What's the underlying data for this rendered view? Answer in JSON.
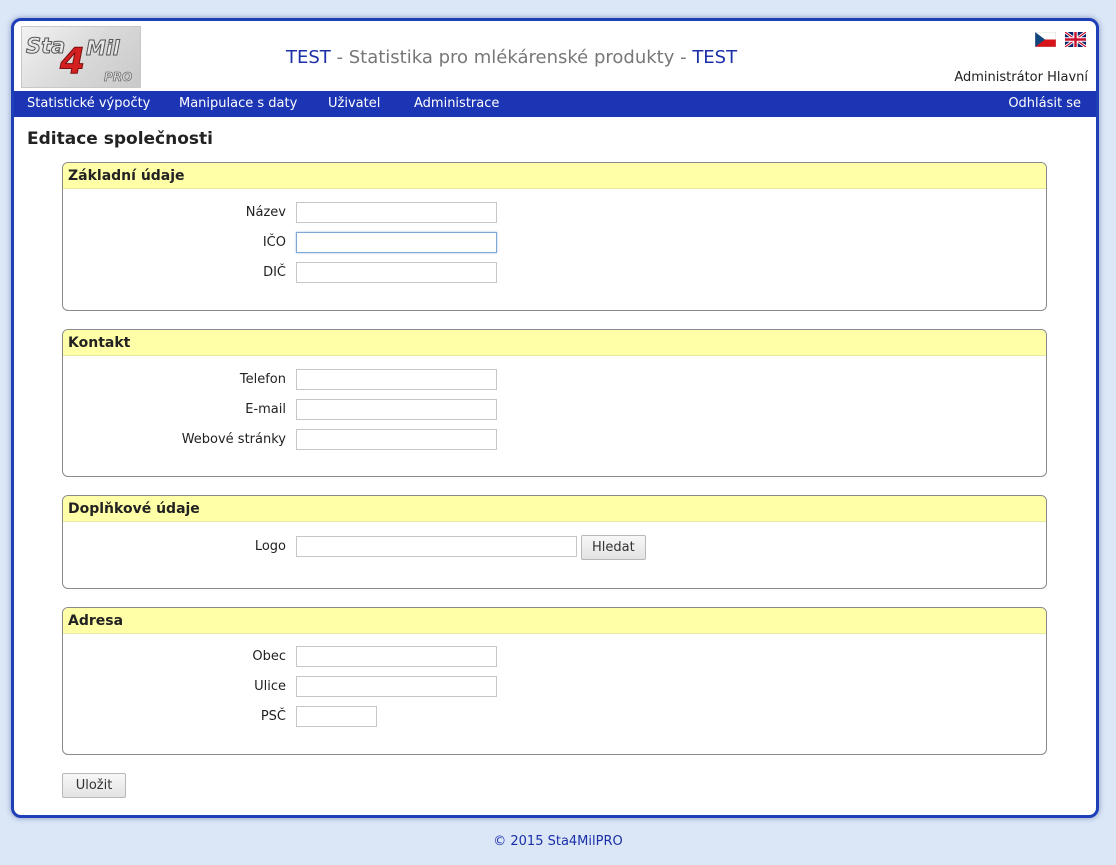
{
  "header": {
    "logo_text": "Sta4Mil PRO",
    "title_prefix": "TEST",
    "title_main": " - Statistika pro mlékárenské produkty - ",
    "title_suffix": "TEST",
    "user_name": "Administrátor Hlavní",
    "flags": [
      "cz-flag-icon",
      "uk-flag-icon"
    ]
  },
  "nav": {
    "items": [
      "Statistické výpočty",
      "Manipulace s daty",
      "Uživatel",
      "Administrace"
    ],
    "logout": "Odhlásit se"
  },
  "page": {
    "title": "Editace společnosti"
  },
  "sections": {
    "basic": {
      "title": "Základní údaje",
      "fields": [
        {
          "label": "Název",
          "value": ""
        },
        {
          "label": "IČO",
          "value": ""
        },
        {
          "label": "DIČ",
          "value": ""
        }
      ]
    },
    "contact": {
      "title": "Kontakt",
      "fields": [
        {
          "label": "Telefon",
          "value": ""
        },
        {
          "label": "E-mail",
          "value": ""
        },
        {
          "label": "Webové stránky",
          "value": ""
        }
      ]
    },
    "extra": {
      "title": "Doplňkové údaje",
      "logo_label": "Logo",
      "logo_value": "",
      "browse_label": "Hledat"
    },
    "address": {
      "title": "Adresa",
      "fields": [
        {
          "label": "Obec",
          "value": ""
        },
        {
          "label": "Ulice",
          "value": ""
        },
        {
          "label": "PSČ",
          "value": ""
        }
      ]
    }
  },
  "save_label": "Uložit",
  "footer": "© 2015 Sta4MilPRO",
  "colors": {
    "nav_bg": "#1c35b5",
    "section_head_bg": "#ffffa8",
    "page_bg": "#dbe7f7",
    "title_accent": "#1a2fa8"
  }
}
